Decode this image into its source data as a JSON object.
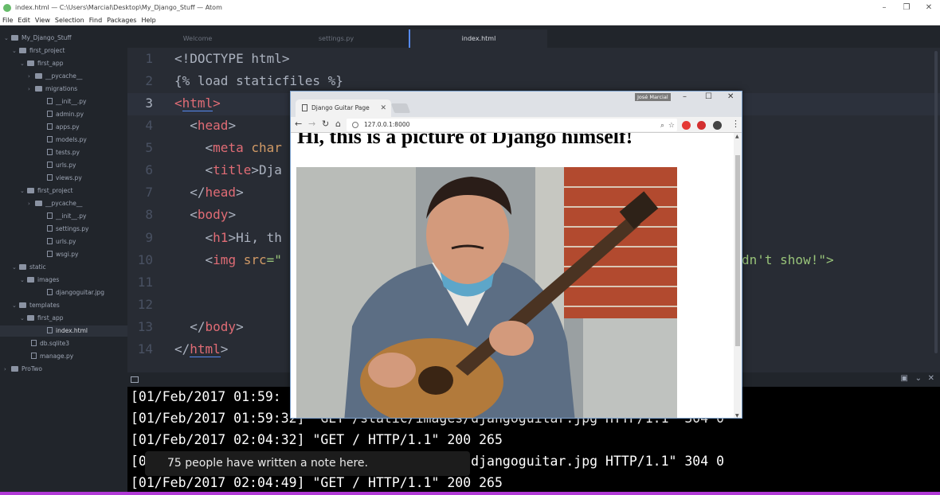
{
  "window": {
    "title": "index.html — C:\\Users\\Marcial\\Desktop\\My_Django_Stuff — Atom",
    "controls": [
      "–",
      "❐",
      "✕"
    ]
  },
  "menu": [
    "File",
    "Edit",
    "View",
    "Selection",
    "Find",
    "Packages",
    "Help"
  ],
  "tree": {
    "items": [
      {
        "label": "My_Django_Stuff",
        "kind": "folder",
        "open": true
      },
      {
        "label": "first_project",
        "kind": "folder",
        "open": true
      },
      {
        "label": "first_app",
        "kind": "folder",
        "open": true
      },
      {
        "label": "__pycache__",
        "kind": "folder",
        "open": false
      },
      {
        "label": "migrations",
        "kind": "folder",
        "open": false
      },
      {
        "label": "__init__.py",
        "kind": "file"
      },
      {
        "label": "admin.py",
        "kind": "file"
      },
      {
        "label": "apps.py",
        "kind": "file"
      },
      {
        "label": "models.py",
        "kind": "file"
      },
      {
        "label": "tests.py",
        "kind": "file"
      },
      {
        "label": "urls.py",
        "kind": "file"
      },
      {
        "label": "views.py",
        "kind": "file"
      },
      {
        "label": "first_project",
        "kind": "folder",
        "open": true
      },
      {
        "label": "__pycache__",
        "kind": "folder",
        "open": false
      },
      {
        "label": "__init__.py",
        "kind": "file"
      },
      {
        "label": "settings.py",
        "kind": "file"
      },
      {
        "label": "urls.py",
        "kind": "file"
      },
      {
        "label": "wsgi.py",
        "kind": "file"
      },
      {
        "label": "static",
        "kind": "folder",
        "open": true
      },
      {
        "label": "images",
        "kind": "folder",
        "open": true
      },
      {
        "label": "djangoguitar.jpg",
        "kind": "file"
      },
      {
        "label": "templates",
        "kind": "folder",
        "open": true
      },
      {
        "label": "first_app",
        "kind": "folder",
        "open": true
      },
      {
        "label": "index.html",
        "kind": "file",
        "selected": true
      },
      {
        "label": "db.sqlite3",
        "kind": "file"
      },
      {
        "label": "manage.py",
        "kind": "file"
      },
      {
        "label": "ProTwo",
        "kind": "folder",
        "open": false
      }
    ]
  },
  "tabs": [
    {
      "label": "Welcome",
      "active": false
    },
    {
      "label": "settings.py",
      "active": false
    },
    {
      "label": "index.html",
      "active": true
    }
  ],
  "editor": {
    "line_numbers": [
      "1",
      "2",
      "3",
      "4",
      "5",
      "6",
      "7",
      "8",
      "9",
      "10",
      "11",
      "12",
      "13",
      "14"
    ],
    "current_line": "3",
    "lines": {
      "l1": "<!DOCTYPE html>",
      "l2": "{% load staticfiles %}",
      "l3_open": "<",
      "l3_tag": "html",
      "l3_close": ">",
      "l4_open": "<",
      "l4_tag": "head",
      "l4_close": ">",
      "l5_open": "<",
      "l5_tag": "meta",
      "l5_attr": " char",
      "l6_open": "<",
      "l6_tag": "title",
      "l6_rest": ">Dja",
      "l7_open": "</",
      "l7_tag": "head",
      "l7_close": ">",
      "l8_open": "<",
      "l8_tag": "body",
      "l8_close": ">",
      "l9_open": "<",
      "l9_tag": "h1",
      "l9_rest": ">Hi, th",
      "l10_open": "<",
      "l10_tag": "img",
      "l10_attr": " src",
      "l10_eq": "=\"",
      "l10_tail": "dn't show!\">",
      "l13_open": "</",
      "l13_tag": "body",
      "l13_close": ">",
      "l14_open": "</",
      "l14_tag": "html",
      "l14_close": ">"
    }
  },
  "terminal": {
    "lines": [
      "[01/Feb/2017 01:59:",
      "[01/Feb/2017 01:59:32] \"GET /static/images/djangoguitar.jpg HTTP/1.1\" 304 0",
      "[01/Feb/2017 02:04:32] \"GET / HTTP/1.1\" 200 265",
      "[0                                      es/djangoguitar.jpg HTTP/1.1\" 304 0",
      "[01/Feb/2017 02:04:49] \"GET / HTTP/1.1\" 200 265"
    ]
  },
  "notification": {
    "text": "75 people have written a note here."
  },
  "browser": {
    "tab_title": "Django Guitar Page",
    "tab_close": "✕",
    "user_badge": "José Marcial",
    "controls": [
      "–",
      "☐",
      "✕"
    ],
    "url": "127.0.0.1:8000",
    "page_heading": "Hi, this is a picture of Django himself!"
  },
  "colors": {
    "atom_bg": "#282c34",
    "tree_bg": "#21252b",
    "accent_blue": "#568af2",
    "terminal_bg": "#000000",
    "bottom_bar": "#b13ad6"
  }
}
